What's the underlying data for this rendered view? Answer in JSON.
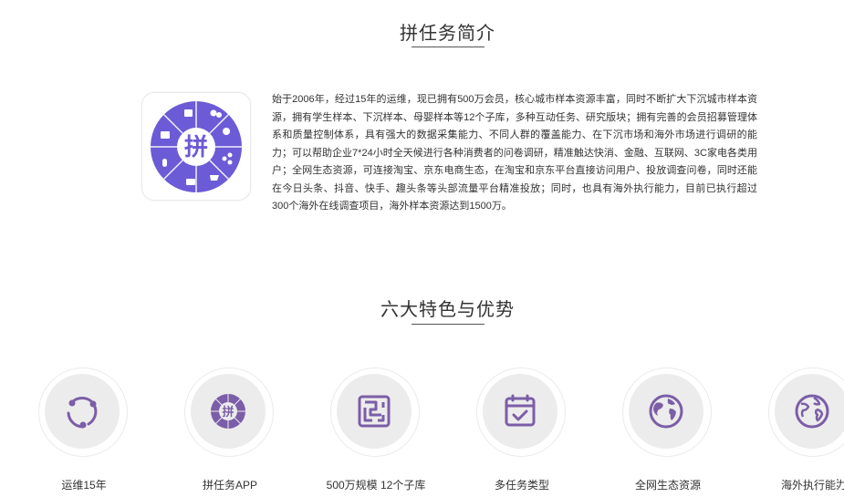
{
  "intro": {
    "title": "拼任务简介",
    "logo_char": "拼",
    "text": "始于2006年，经过15年的运维，现已拥有500万会员，核心城市样本资源丰富，同时不断扩大下沉城市样本资源，拥有学生样本、下沉样本、母婴样本等12个子库，多种互动任务、研究版块；拥有完善的会员招募管理体系和质量控制体系，具有强大的数据采集能力、不同人群的覆盖能力、在下沉市场和海外市场进行调研的能力；可以帮助企业7*24小时全天候进行各种消费者的问卷调研，精准触达快消、金融、互联网、3C家电各类用户；全网生态资源，可连接淘宝、京东电商生态，在淘宝和京东平台直接访问用户、投放调查问卷，同时还能在今日头条、抖音、快手、趣头条等头部流量平台精准投放；同时，也具有海外执行能力，目前已执行超过300个海外在线调查项目，海外样本资源达到1500万。"
  },
  "features": {
    "title": "六大特色与优势",
    "items": [
      {
        "label": "运维15年",
        "icon": "cycle-icon"
      },
      {
        "label": "拼任务APP",
        "icon": "app-logo-icon"
      },
      {
        "label": "500万规模 12个子库",
        "icon": "maze-icon"
      },
      {
        "label": "多任务类型",
        "icon": "calendar-check-icon"
      },
      {
        "label": "全网生态资源",
        "icon": "globe-icon"
      },
      {
        "label": "海外执行能力",
        "icon": "globe-icon"
      }
    ]
  },
  "colors": {
    "accent": "#7b5ea7",
    "logo_purple": "#6b5bd6"
  }
}
